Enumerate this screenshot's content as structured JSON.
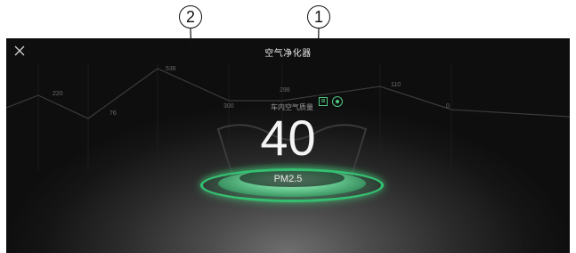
{
  "callouts": [
    "2",
    "1"
  ],
  "header": {
    "title": "空气净化器",
    "close_icon": "close-icon"
  },
  "air_quality": {
    "label": "车内空气质量",
    "value": "40",
    "unit": "PM2.5",
    "status_icons": [
      "filter-icon",
      "sync-icon"
    ],
    "accent_color": "#3cc878"
  },
  "history_chart": {
    "labels": [
      "220",
      "76",
      "536",
      "300",
      "298",
      "110",
      "0"
    ]
  }
}
